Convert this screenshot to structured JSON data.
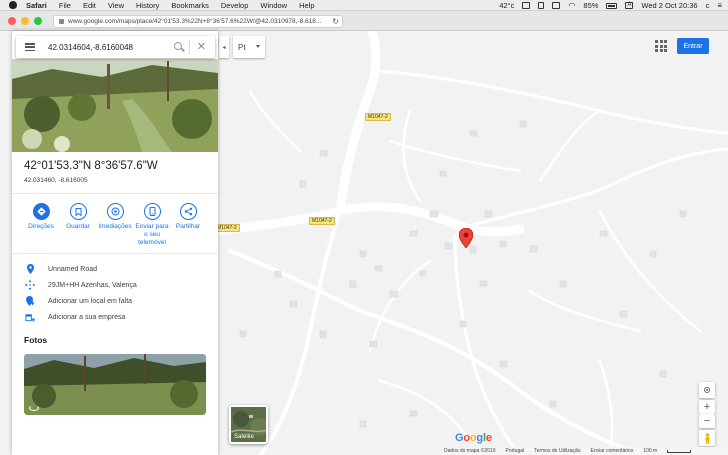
{
  "menubar": {
    "app_name": "Safari",
    "items": [
      "File",
      "Edit",
      "View",
      "History",
      "Bookmarks",
      "Develop",
      "Window",
      "Help"
    ],
    "temperature": "42°c",
    "battery": "85%",
    "datetime": "Wed 2 Oct  20:36",
    "user_initial": "c",
    "input_source": "A"
  },
  "browser": {
    "url": "www.google.com/maps/place/42°01'53.3%22N+8°36'57.6%22W/@42.0310978,-8.618..."
  },
  "search": {
    "value": "42.0314604,-8.6160048"
  },
  "place": {
    "title": "42°01'53.3\"N 8°36'57.6\"W",
    "subtitle": "42.031460, -8.616005"
  },
  "actions": [
    {
      "label": "Direções",
      "icon": "directions-icon"
    },
    {
      "label": "Guardar",
      "icon": "bookmark-icon"
    },
    {
      "label": "Imediações",
      "icon": "nearby-icon"
    },
    {
      "label": "Enviar para o seu telemóvel",
      "icon": "phone-icon"
    },
    {
      "label": "Partilhar",
      "icon": "share-icon"
    }
  ],
  "info": [
    {
      "text": "Unnamed Road",
      "icon": "location-pin-icon"
    },
    {
      "text": "29JM+HH Azenhas, Valença",
      "icon": "plus-code-icon"
    },
    {
      "text": "Adicionar um local em falta",
      "icon": "add-place-icon"
    },
    {
      "text": "Adicionar a sua empresa",
      "icon": "add-business-icon"
    }
  ],
  "photos": {
    "heading": "Fotos"
  },
  "map": {
    "layer_selector": "Pt",
    "road_labels": [
      "M1047-2",
      "M1047-2",
      "M1047-2"
    ],
    "satellite_label": "Satélite",
    "sign_in": "Entrar",
    "google_logo": "Google"
  },
  "footer": {
    "map_data": "Dados do mapa ©2019",
    "country": "Portugal",
    "terms": "Termos de Utilização",
    "feedback": "Enviar comentários",
    "scale": "100 m"
  },
  "colors": {
    "accent": "#1a73e8",
    "marker": "#ea4335",
    "road_label_bg": "#f8e57a"
  }
}
